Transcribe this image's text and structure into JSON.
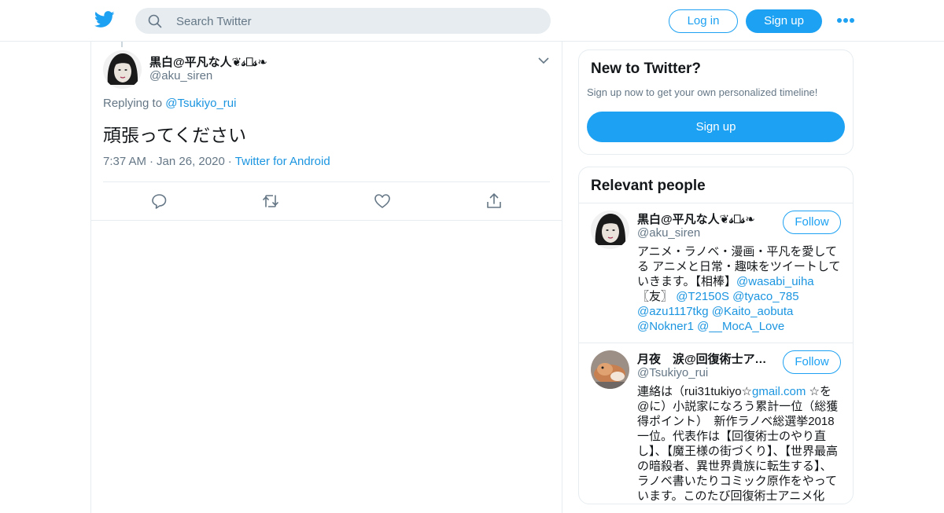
{
  "header": {
    "logo": "twitter-bird-icon",
    "search_placeholder": "Search Twitter",
    "login_label": "Log in",
    "signup_label": "Sign up",
    "more_icon": "more-dots-icon",
    "brand_color": "#1da1f2"
  },
  "tweet": {
    "author_name": "黒白@平凡な人❦𝓈⎕𝓈❧",
    "author_handle": "@aku_siren",
    "replying_prefix": "Replying to",
    "replying_to": "@Tsukiyo_rui",
    "text": "頑張ってください",
    "time": "7:37 AM",
    "date": "Jan 26, 2020",
    "source": "Twitter for Android",
    "separator": "·",
    "actions": [
      "reply-icon",
      "retweet-icon",
      "like-icon",
      "share-icon"
    ]
  },
  "sidebar": {
    "new_to_twitter": {
      "title": "New to Twitter?",
      "subtitle": "Sign up now to get your own personalized timeline!",
      "button": "Sign up"
    },
    "relevant": {
      "title": "Relevant people",
      "people": [
        {
          "name": "黒白@平凡な人❦𝓈⎕𝓈❧",
          "handle": "@aku_siren",
          "follow": "Follow",
          "bio_line1": "アニメ・ラノベ・漫画・平凡を愛してる アニメと日常・趣味をツイートしていきます。【相棒】",
          "bio_link1": "@wasabi_uiha",
          "bio_mid": "〖友〗",
          "bio_links": [
            "@T2150S",
            "@tyaco_785",
            "@azu1117tkg",
            "@Kaito_aobuta",
            "@Nokner1",
            "@__MocA_Love"
          ]
        },
        {
          "name": "月夜　涙@回復術士アニメ化",
          "handle": "@Tsukiyo_rui",
          "follow": "Follow",
          "bio_part1": "連絡は（rui31tukiyo☆",
          "bio_link": "gmail.com",
          "bio_part2": " ☆を@に）小説家になろう累計一位（総獲得ポイント）　新作ラノベ総選挙2018一位。代表作は【回復術士のやり直し】、【魔王様の街づくり】、【世界最高の暗殺者、異世界貴族に転生する】、ラノベ書いたりコミック原作をやっています。このたび回復術士アニメ化"
        }
      ]
    }
  }
}
